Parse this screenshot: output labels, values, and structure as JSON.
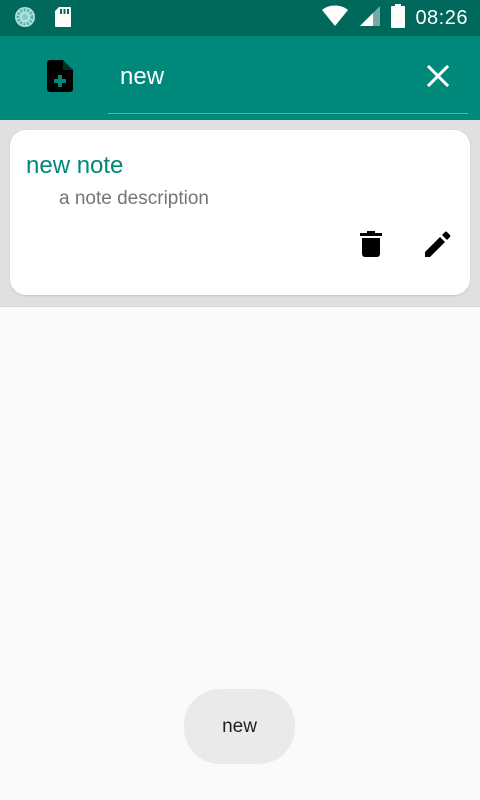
{
  "status_bar": {
    "time": "08:26",
    "icons": [
      "app-notification-icon",
      "sd-card-icon",
      "wifi-icon",
      "cell-signal-icon",
      "battery-icon"
    ]
  },
  "app_bar": {
    "add_icon": "note-add-icon",
    "search": {
      "value": "new",
      "placeholder": ""
    },
    "clear_icon": "close-icon"
  },
  "notes": [
    {
      "title": "new note",
      "description": "a note description",
      "actions": [
        "delete-icon",
        "edit-icon"
      ]
    }
  ],
  "toast": {
    "text": "new"
  },
  "colors": {
    "status_bar": "#00695c",
    "primary": "#00897b",
    "title_text": "#00897b",
    "description_text": "#757575",
    "background": "#fafafa",
    "list_background": "#e0e0e0"
  }
}
